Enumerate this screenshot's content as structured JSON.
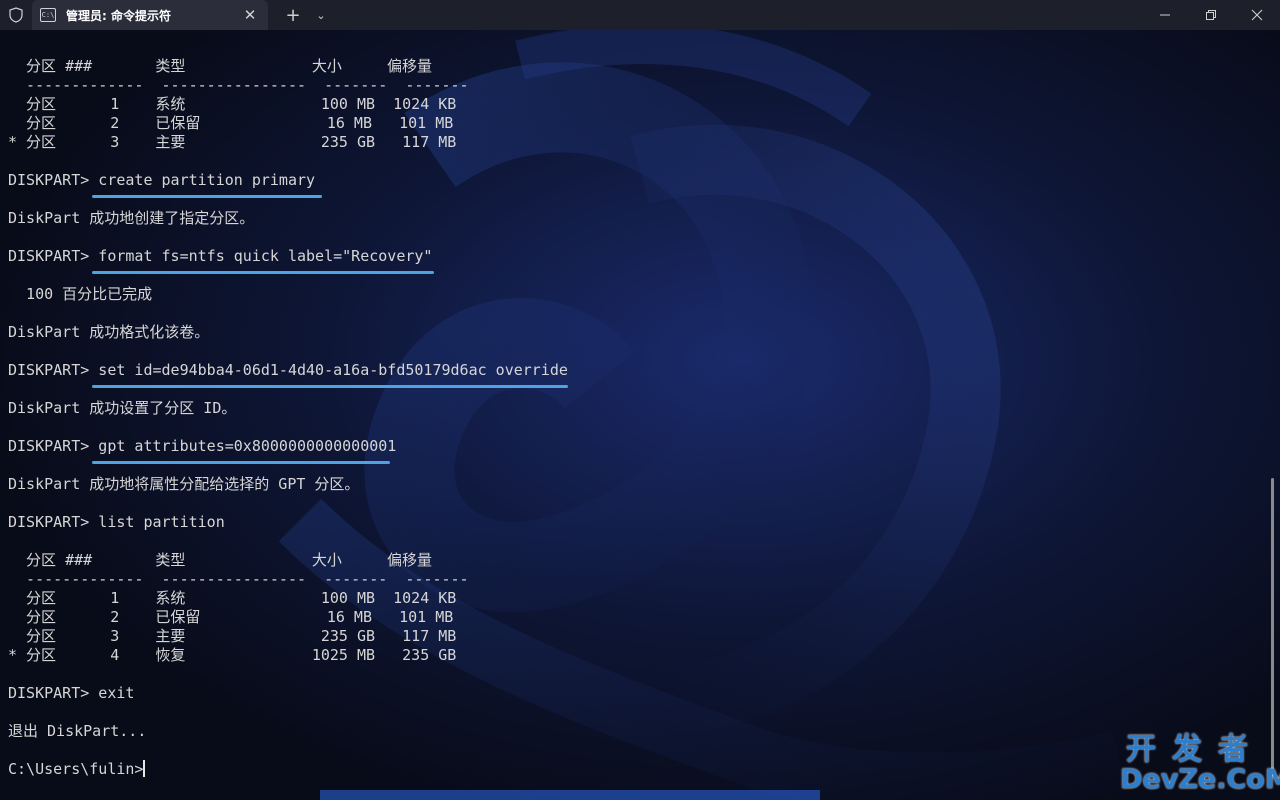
{
  "window": {
    "tab_title": "管理员: 命令提示符",
    "tab_icon_text": "C:\\",
    "close_tab_glyph": "✕",
    "new_tab_glyph": "+",
    "dropdown_glyph": "⌄"
  },
  "terminal": {
    "lines": [
      "  分区 ###       类型              大小     偏移量",
      "  -------------  ----------------  -------  -------",
      "  分区      1    系统               100 MB  1024 KB",
      "  分区      2    已保留              16 MB   101 MB",
      "* 分区      3    主要               235 GB   117 MB",
      "",
      "DISKPART> create partition primary",
      "",
      "DiskPart 成功地创建了指定分区。",
      "",
      "DISKPART> format fs=ntfs quick label=\"Recovery\"",
      "",
      "  100 百分比已完成",
      "",
      "DiskPart 成功格式化该卷。",
      "",
      "DISKPART> set id=de94bba4-06d1-4d40-a16a-bfd50179d6ac override",
      "",
      "DiskPart 成功设置了分区 ID。",
      "",
      "DISKPART> gpt attributes=0x8000000000000001",
      "",
      "DiskPart 成功地将属性分配给选择的 GPT 分区。",
      "",
      "DISKPART> list partition",
      "",
      "  分区 ###       类型              大小     偏移量",
      "  -------------  ----------------  -------  -------",
      "  分区      1    系统               100 MB  1024 KB",
      "  分区      2    已保留              16 MB   101 MB",
      "  分区      3    主要               235 GB   117 MB",
      "* 分区      4    恢复              1025 MB   235 GB",
      "",
      "DISKPART> exit",
      "",
      "退出 DiskPart...",
      "",
      "C:\\Users\\fulin>"
    ]
  },
  "watermark": {
    "top": "开发者",
    "bottom": "DevZe.CoM"
  },
  "colors": {
    "underline": "#4fa3e3",
    "watermark": "#2f7ecb",
    "titlebar": "#1d1f2b",
    "text": "#d6d6d6"
  }
}
